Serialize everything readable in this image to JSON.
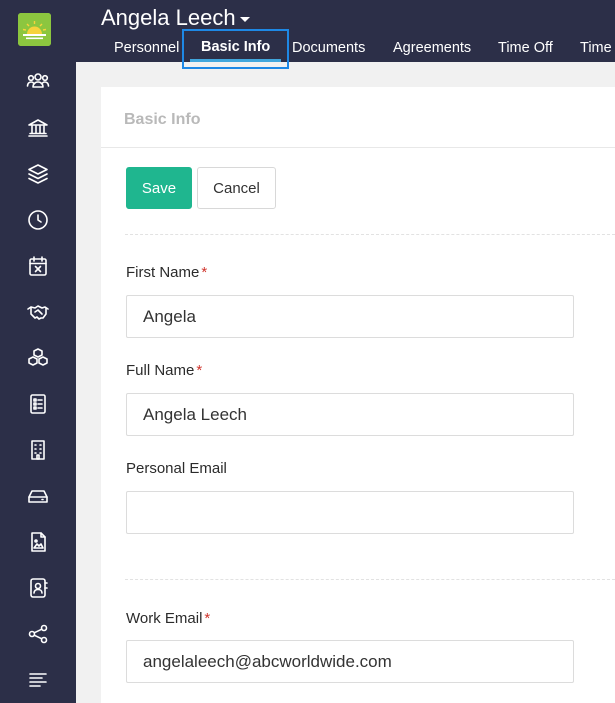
{
  "header": {
    "employee_name": "Angela Leech",
    "tabs": [
      {
        "label": "Personnel"
      },
      {
        "label": "Basic Info"
      },
      {
        "label": "Documents"
      },
      {
        "label": "Agreements"
      },
      {
        "label": "Time Off"
      },
      {
        "label": "Time"
      }
    ]
  },
  "sidebar": {
    "icons": [
      "users-icon",
      "bank-icon",
      "layers-icon",
      "clock-icon",
      "calendar-x-icon",
      "handshake-icon",
      "cubes-icon",
      "checklist-icon",
      "building-icon",
      "drive-icon",
      "image-file-icon",
      "contact-book-icon",
      "share-icon",
      "menu-icon"
    ]
  },
  "form": {
    "title": "Basic Info",
    "save_label": "Save",
    "cancel_label": "Cancel",
    "required_mark": "*",
    "fields": {
      "first_name": {
        "label": "First Name",
        "value": "Angela",
        "required": true
      },
      "full_name": {
        "label": "Full Name",
        "value": "Angela Leech",
        "required": true
      },
      "personal_email": {
        "label": "Personal Email",
        "value": "",
        "required": false
      },
      "work_email": {
        "label": "Work Email",
        "value": "angelaleech@abcworldwide.com",
        "required": true
      }
    }
  },
  "colors": {
    "nav_bg": "#2c2f48",
    "accent_green": "#1fb68f",
    "logo_green": "#8cc63f",
    "required_red": "#d0342c",
    "active_tab_outline": "#1e88e5"
  }
}
